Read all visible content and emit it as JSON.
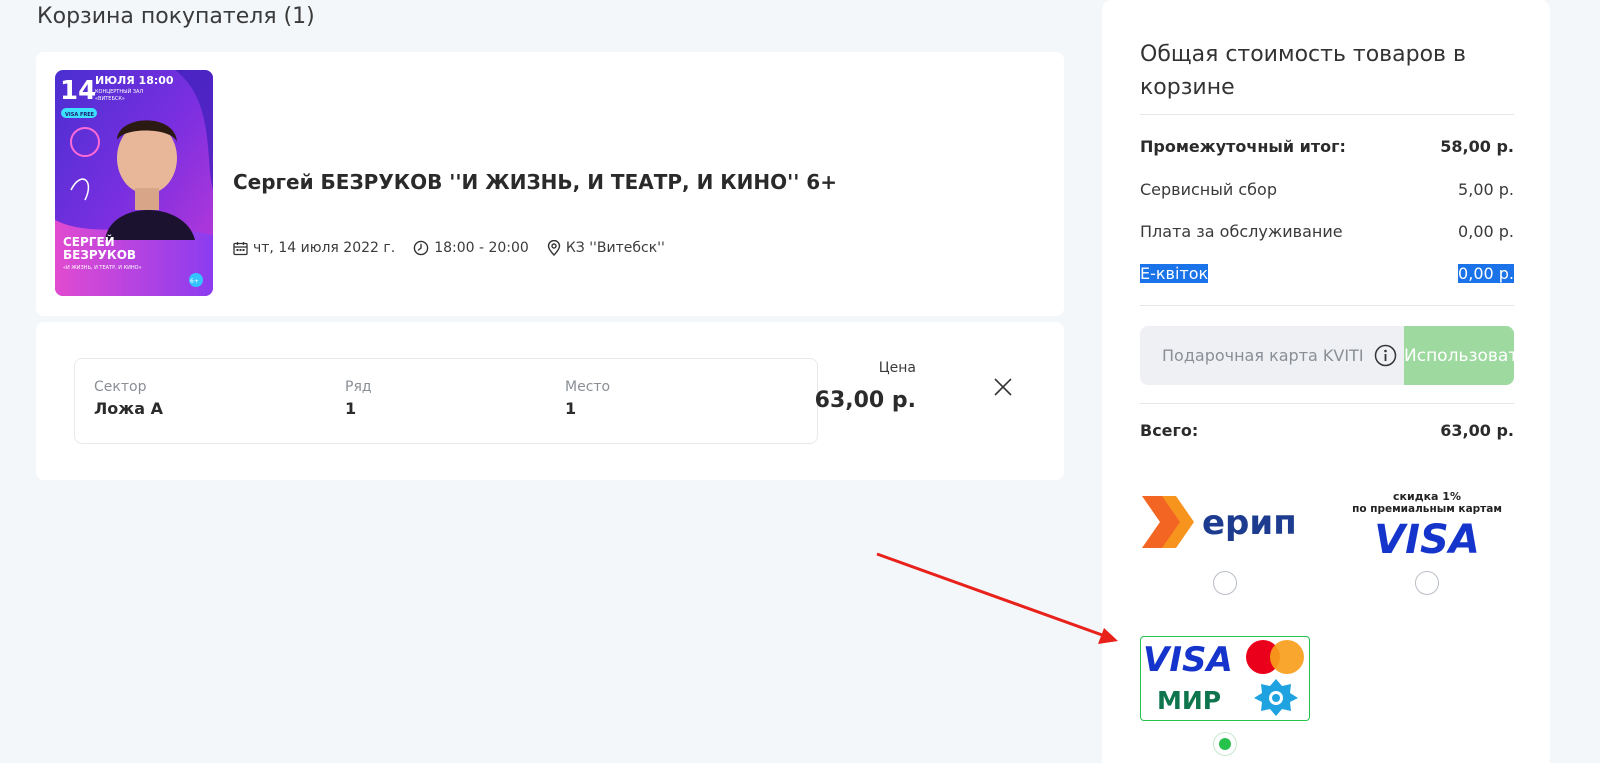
{
  "cart": {
    "title": "Корзина покупателя (1)"
  },
  "event": {
    "poster": {
      "date_num": "14",
      "date_text": "ИЮЛЯ 18:00",
      "venue_line1": "КОНЦЕРТНЫЙ ЗАЛ",
      "venue_line2": "«ВИТЕБСК»",
      "badge": "VISA FREE",
      "name_line1": "СЕРГЕЙ",
      "name_line2": "БЕЗРУКОВ",
      "subtitle": "«И ЖИЗНЬ, И ТЕАТР, И КИНО»",
      "age": "6+"
    },
    "title": "Сергей БЕЗРУКОВ ''И ЖИЗНЬ, И ТЕАТР, И КИНО'' 6+",
    "date": "чт, 14 июля 2022 г.",
    "time": "18:00 - 20:00",
    "venue": "КЗ ''Витебск''"
  },
  "ticket": {
    "sector_label": "Сектор",
    "sector_value": "Ложа А",
    "row_label": "Ряд",
    "row_value": "1",
    "seat_label": "Место",
    "seat_value": "1",
    "price_label": "Цена",
    "price_value": "63,00 р."
  },
  "summary": {
    "title": "Общая стоимость товаров в корзине",
    "subtotal_label": "Промежуточный итог:",
    "subtotal_value": "58,00 р.",
    "service_label": "Сервисный сбор",
    "service_value": "5,00 р.",
    "maintenance_label": "Плата за обслуживание",
    "maintenance_value": "0,00 р.",
    "eticket_label": "Е-квіток",
    "eticket_value": "0,00 р.",
    "gift_placeholder": "Подарочная карта KVITI",
    "gift_button": "Использовать",
    "total_label": "Всего:",
    "total_value": "63,00 р."
  },
  "payment": {
    "erip_label": "ерип",
    "visa_promo_line1": "скидка 1%",
    "visa_promo_line2": "по премиальным картам",
    "visa_label": "VISA",
    "cards_visa": "VISA",
    "cards_mir": "МИР",
    "selected": "cards",
    "colors": {
      "selected": "#27c24c",
      "visa_blue": "#1434cb",
      "mir_green": "#0f754e",
      "erip_orange": "#f26522",
      "erip_blue": "#1d3c8f"
    }
  }
}
